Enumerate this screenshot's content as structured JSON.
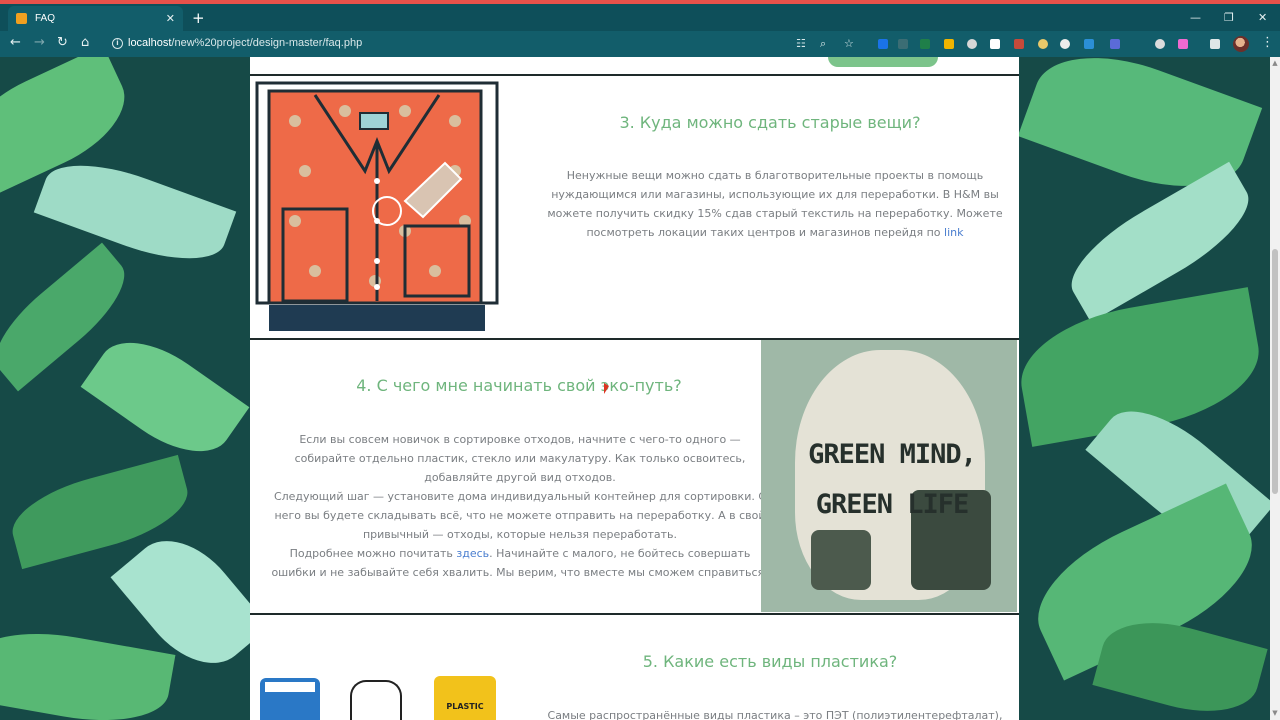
{
  "browser": {
    "tab_title": "FAQ",
    "tab_close": "✕",
    "new_tab": "+",
    "url_host": "localhost",
    "url_path": "/new%20project/design-master/faq.php",
    "window_controls": [
      "—",
      "❐",
      "✕"
    ]
  },
  "faq": {
    "q3": {
      "title": "3. Куда можно сдать старые вещи?",
      "body": "Ненужные вещи можно сдать в благотворительные проекты в помощь нуждающимся или магазины, использующие их для переработки. В H&M вы можете получить скидку 15% сдав старый текстиль на переработку. Можете посмотреть локации таких центров и магазинов перейдя по",
      "link": "link"
    },
    "q4": {
      "title": "4. С чего мне начинать свой эко-путь?",
      "p1": "Если вы совсем новичок в сортировке отходов, начните с чего-то одного — собирайте отдельно пластик, стекло или макулатуру. Как только освоитесь, добавляйте другой вид отходов.",
      "p2": "Следующий шаг — установите дома индивидуальный контейнер для сортировки. С него вы будете складывать всё, что не можете отправить на переработку. А в свой привычный — отходы, которые нельзя переработать.",
      "p3_before": "Подробнее можно почитать",
      "p3_link": "здесь",
      "p3_after": ". Начинайте с малого, не бойтесь совершать ошибки и не забывайте себя хвалить. Мы верим, что вместе мы сможем справиться!",
      "image_text": "GREEN MIND, GREEN LIFE"
    },
    "q5": {
      "title": "5. Какие есть виды пластика?",
      "body": "Самые распространённые виды пластика – это ПЭТ (полиэтилентерефталат),",
      "bin_label": "PLASTIC"
    }
  },
  "colors": {
    "chrome_tab": "#0e4f5a",
    "chrome_toolbar": "#125d6a",
    "accent": "#e8514a",
    "title_green": "#6fb57d",
    "shirt_orange": "#ee6a48",
    "link_blue": "#4a7ecf"
  },
  "icons": [
    "back-arrow-icon",
    "forward-arrow-icon",
    "reload-icon",
    "home-icon",
    "info-icon",
    "translate-icon",
    "zoom-icon",
    "star-icon",
    "extension-icon",
    "menu-icon"
  ]
}
